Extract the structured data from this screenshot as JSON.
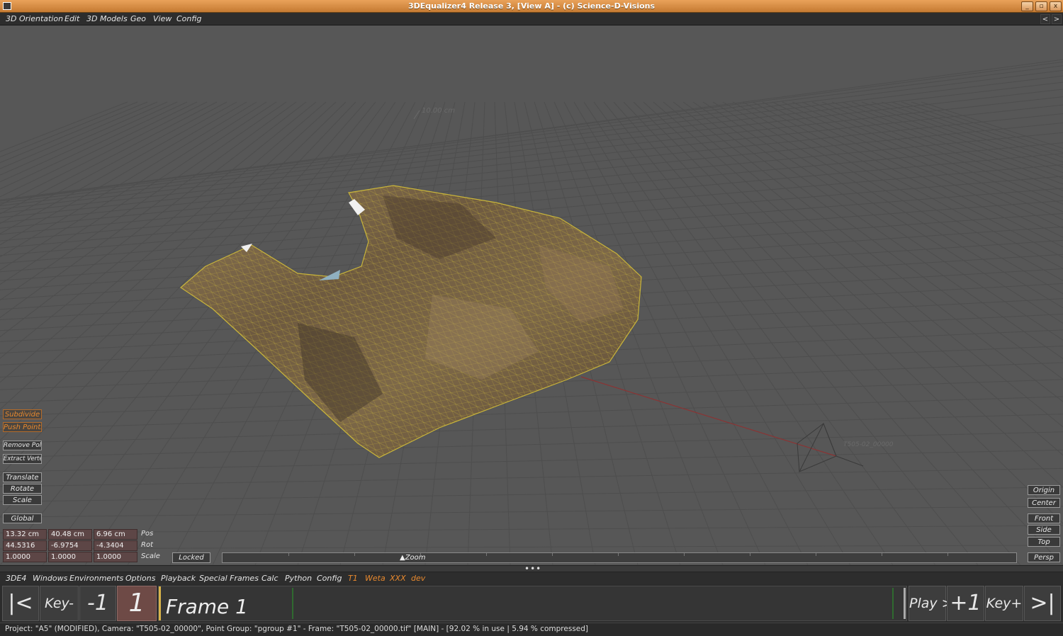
{
  "window": {
    "title": "3DEqualizer4 Release 3, [View A]  -  (c) Science-D-Visions",
    "buttons": [
      "_",
      "▫",
      "x"
    ]
  },
  "top_menu": {
    "items": [
      "3D Orientation",
      "Edit",
      "3D Models",
      "Geo",
      "View",
      "Config"
    ],
    "nav_prev": "<",
    "nav_next": ">"
  },
  "viewport": {
    "grid_label": "10.00 cm",
    "camera_label": "T505-02_00000",
    "left_tools": {
      "subdivide": "Subdivide",
      "push_points": "Push Points",
      "remove_poly": "Remove Poly",
      "extract_vertex": "Extract Vertex",
      "translate": "Translate",
      "rotate": "Rotate",
      "scale": "Scale",
      "global": "Global"
    },
    "transform": {
      "pos": [
        "13.32 cm",
        "40.48 cm",
        "6.96 cm"
      ],
      "rot": [
        "44.5316",
        "-6.9754",
        "-4.3404"
      ],
      "scale": [
        "1.0000",
        "1.0000",
        "1.0000"
      ],
      "pos_label": "Pos",
      "rot_label": "Rot",
      "scale_label": "Scale"
    },
    "locked_label": "Locked",
    "zoom_label": "Zoom",
    "right_tools": {
      "origin": "Origin",
      "center": "Center",
      "front": "Front",
      "side": "Side",
      "top": "Top",
      "persp": "Persp"
    },
    "colors": {
      "background": "#575757",
      "grid": "#4e4e4e",
      "mesh_wire": "#c8b43a",
      "axis_red": "#8a3434"
    }
  },
  "splitter": {
    "dots": "•••"
  },
  "bottom_menu": {
    "items": [
      "3DE4",
      "Windows",
      "Environments",
      "Options",
      "Playback",
      "Special Frames",
      "Calc",
      "Python",
      "Config"
    ],
    "custom_items": [
      "T1",
      "Weta",
      "XXX",
      "dev"
    ]
  },
  "timeline": {
    "first": "|<",
    "key_prev": "Key-",
    "step_back": "-1",
    "current_frame": "1",
    "frame_label": "Frame 1",
    "play": "Play >",
    "step_fwd": "+1",
    "key_next": "Key+",
    "last": ">|"
  },
  "status": {
    "text": "Project: \"A5\"  (MODIFIED), Camera: \"T505-02_00000\", Point Group: \"pgroup #1\"  -  Frame: \"T505-02_00000.tif\"  [MAIN]  -  [92.02 % in use | 5.94 % compressed]"
  }
}
